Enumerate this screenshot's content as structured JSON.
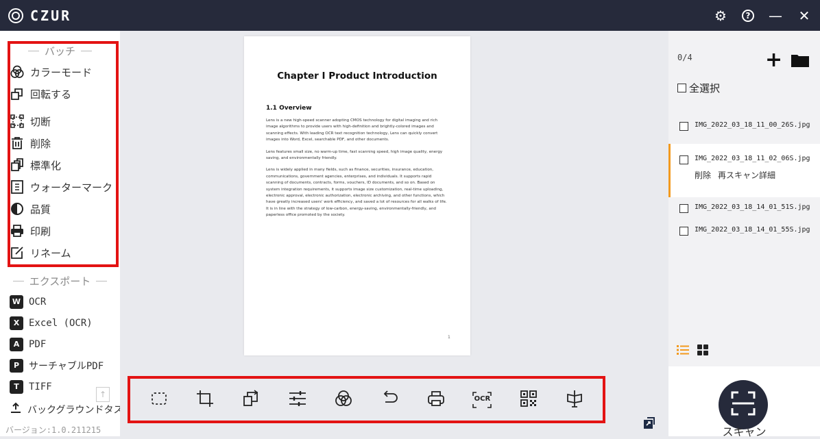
{
  "app": {
    "name": "CZUR"
  },
  "window_controls": {
    "settings": "⚙",
    "help": "?",
    "minimize": "—",
    "close": "✕"
  },
  "sidebar": {
    "batch": {
      "heading": "バッチ",
      "items": [
        {
          "label": "カラーモード",
          "icon": "color-mode-icon"
        },
        {
          "label": "回転する",
          "icon": "rotate-icon"
        },
        {
          "label": "切断",
          "icon": "crop-icon"
        },
        {
          "label": "削除",
          "icon": "trash-icon"
        },
        {
          "label": "標準化",
          "icon": "standardize-icon"
        },
        {
          "label": "ウォーターマーク",
          "icon": "watermark-icon"
        },
        {
          "label": "品質",
          "icon": "quality-icon"
        },
        {
          "label": "印刷",
          "icon": "print-icon"
        },
        {
          "label": "リネーム",
          "icon": "rename-icon"
        }
      ]
    },
    "export": {
      "heading": "エクスポート",
      "items": [
        {
          "label": "OCR",
          "badge": "W"
        },
        {
          "label": "Excel (OCR)",
          "badge": "X"
        },
        {
          "label": "PDF",
          "badge": "A"
        },
        {
          "label": "サーチャブルPDF",
          "badge": "P"
        },
        {
          "label": "TIFF",
          "badge": "T"
        }
      ]
    },
    "background_task": "バックグラウンドタスク",
    "version": "バージョン:1.0.211215"
  },
  "document": {
    "title": "Chapter I Product Introduction",
    "section": "1.1 Overview",
    "paragraphs": [
      "Lens is a new high-speed scanner adopting CMOS technology for digital imaging and rich image algorithms to provide users with high-definition and brightly-colored images and scanning effects. With leading OCR text recognition technology, Lens can quickly convert images into Word, Excel, searchable PDF, and other documents.",
      "Lens features small size, no warm-up time, fast scanning speed, high image quality, energy saving, and environmentally friendly.",
      "Lens is widely applied in many fields, such as finance, securities, insurance, education, communications, government agencies, enterprises, and individuals. It supports rapid scanning of documents, contracts, forms, vouchers, ID documents, and so on. Based on system integration requirements, it supports image size customization, real-time uploading, electronic approval, electronic authorization, electronic archiving, and other functions, which have greatly increased users' work efficiency, and saved a lot of resources for all walks of life. It is in line with the strategy of low-carbon, energy-saving, environmentally-friendly, and paperless office promoted by the society."
    ],
    "page_number": "1"
  },
  "toolbar": {
    "tools": [
      "select-area-icon",
      "crop-icon",
      "rotate-icon",
      "adjust-icon",
      "color-mode-icon",
      "undo-icon",
      "print-icon",
      "ocr-icon",
      "qr-code-icon",
      "flatten-icon"
    ],
    "ocr_label": "OCR"
  },
  "files_panel": {
    "counter": "0/4",
    "select_all": "全選択",
    "files": [
      {
        "name": "IMG_2022_03_18_11_00_26S.jpg",
        "active": false
      },
      {
        "name": "IMG_2022_03_18_11_02_06S.jpg",
        "active": true,
        "actions": [
          "削除",
          "再スキャン",
          "詳細"
        ]
      },
      {
        "name": "IMG_2022_03_18_14_01_51S.jpg",
        "active": false
      },
      {
        "name": "IMG_2022_03_18_14_01_55S.jpg",
        "active": false
      }
    ],
    "scan_label": "スキャン"
  },
  "colors": {
    "titlebar": "#262a3b",
    "highlight": "#e31313",
    "active_accent": "#f39a1e",
    "list_view": "#f39a1e"
  }
}
